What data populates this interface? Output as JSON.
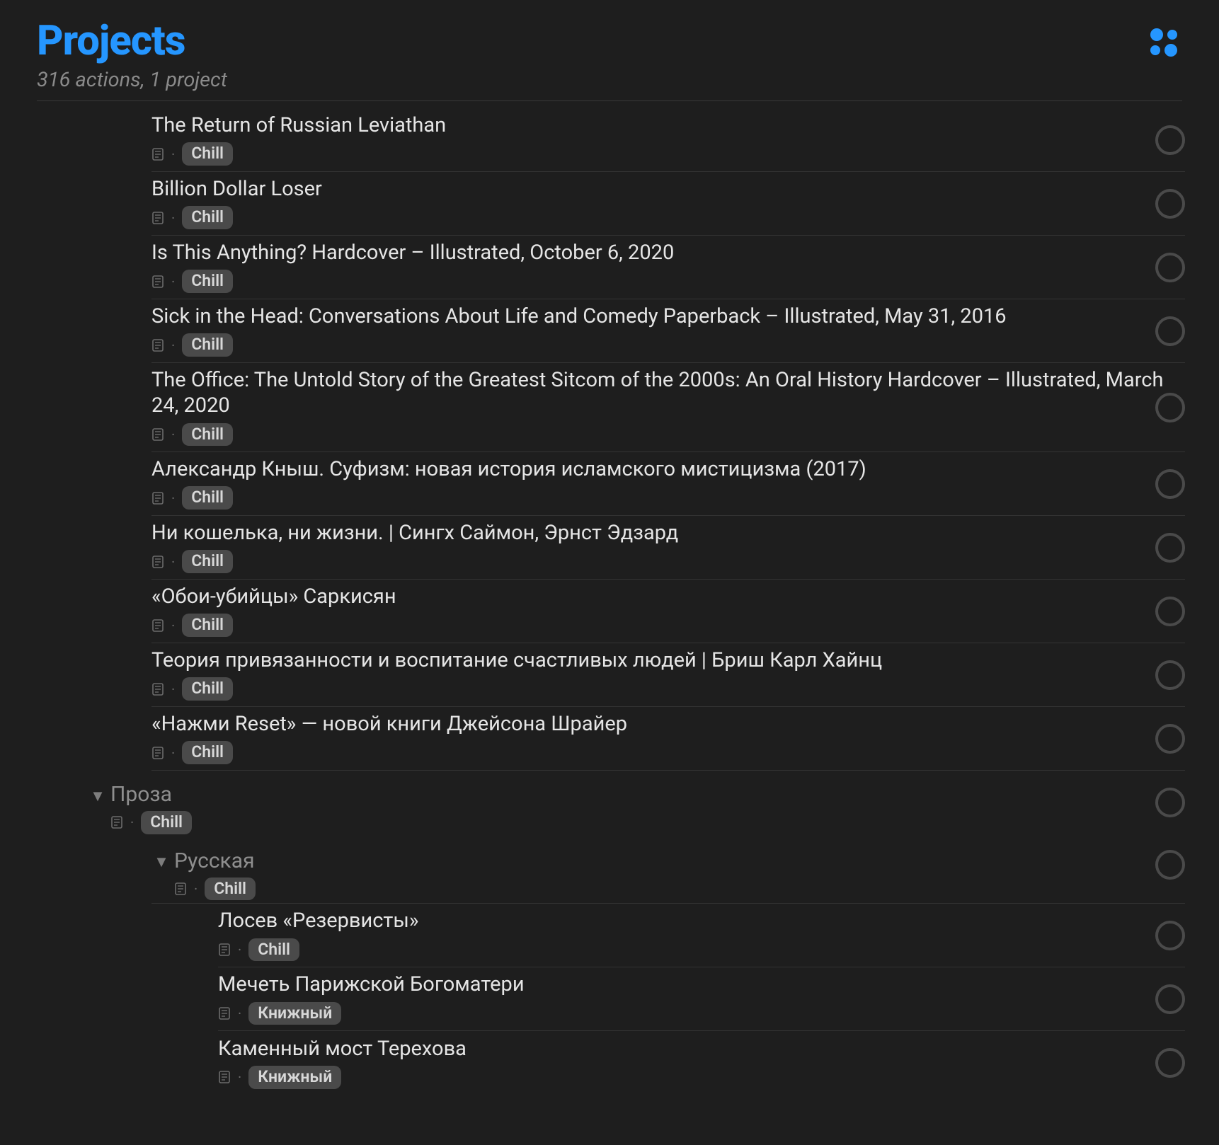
{
  "header": {
    "title": "Projects",
    "subtitle": "316 actions, 1 project"
  },
  "tags": {
    "chill": "Chill",
    "knizhny": "Книжный"
  },
  "tasks": [
    {
      "title": "The Return of Russian Leviathan",
      "tag": "chill"
    },
    {
      "title": "Billion Dollar Loser",
      "tag": "chill"
    },
    {
      "title": "Is This Anything? Hardcover – Illustrated, October 6, 2020",
      "tag": "chill"
    },
    {
      "title": "Sick in the Head: Conversations About Life and Comedy Paperback – Illustrated, May 31, 2016",
      "tag": "chill"
    },
    {
      "title": "The Office: The Untold Story of the Greatest Sitcom of the 2000s: An Oral History Hardcover – Illustrated, March 24, 2020",
      "tag": "chill"
    },
    {
      "title": "Александр Кныш. Суфизм: новая история исламского мистицизма (2017)",
      "tag": "chill"
    },
    {
      "title": "Ни кошелька, ни жизни. | Сингх Саймон, Эрнст Эдзард",
      "tag": "chill"
    },
    {
      "title": "«Обои-убийцы» Саркисян",
      "tag": "chill"
    },
    {
      "title": "Теория привязанности и воспитание счастливых людей | Бриш Карл Хайнц",
      "tag": "chill"
    },
    {
      "title": "«Нажми Reset» — новой книги Джейсона Шрайер",
      "tag": "chill"
    }
  ],
  "groups": {
    "proza": {
      "title": "Проза",
      "tag": "chill"
    },
    "russkaya": {
      "title": "Русская",
      "tag": "chill"
    }
  },
  "subtasks": [
    {
      "title": "Лосев «Резервисты»",
      "tag": "chill"
    },
    {
      "title": "Мечеть Парижской Богоматери",
      "tag": "knizhny"
    },
    {
      "title": "Каменный мост Терехова",
      "tag": "knizhny"
    }
  ]
}
